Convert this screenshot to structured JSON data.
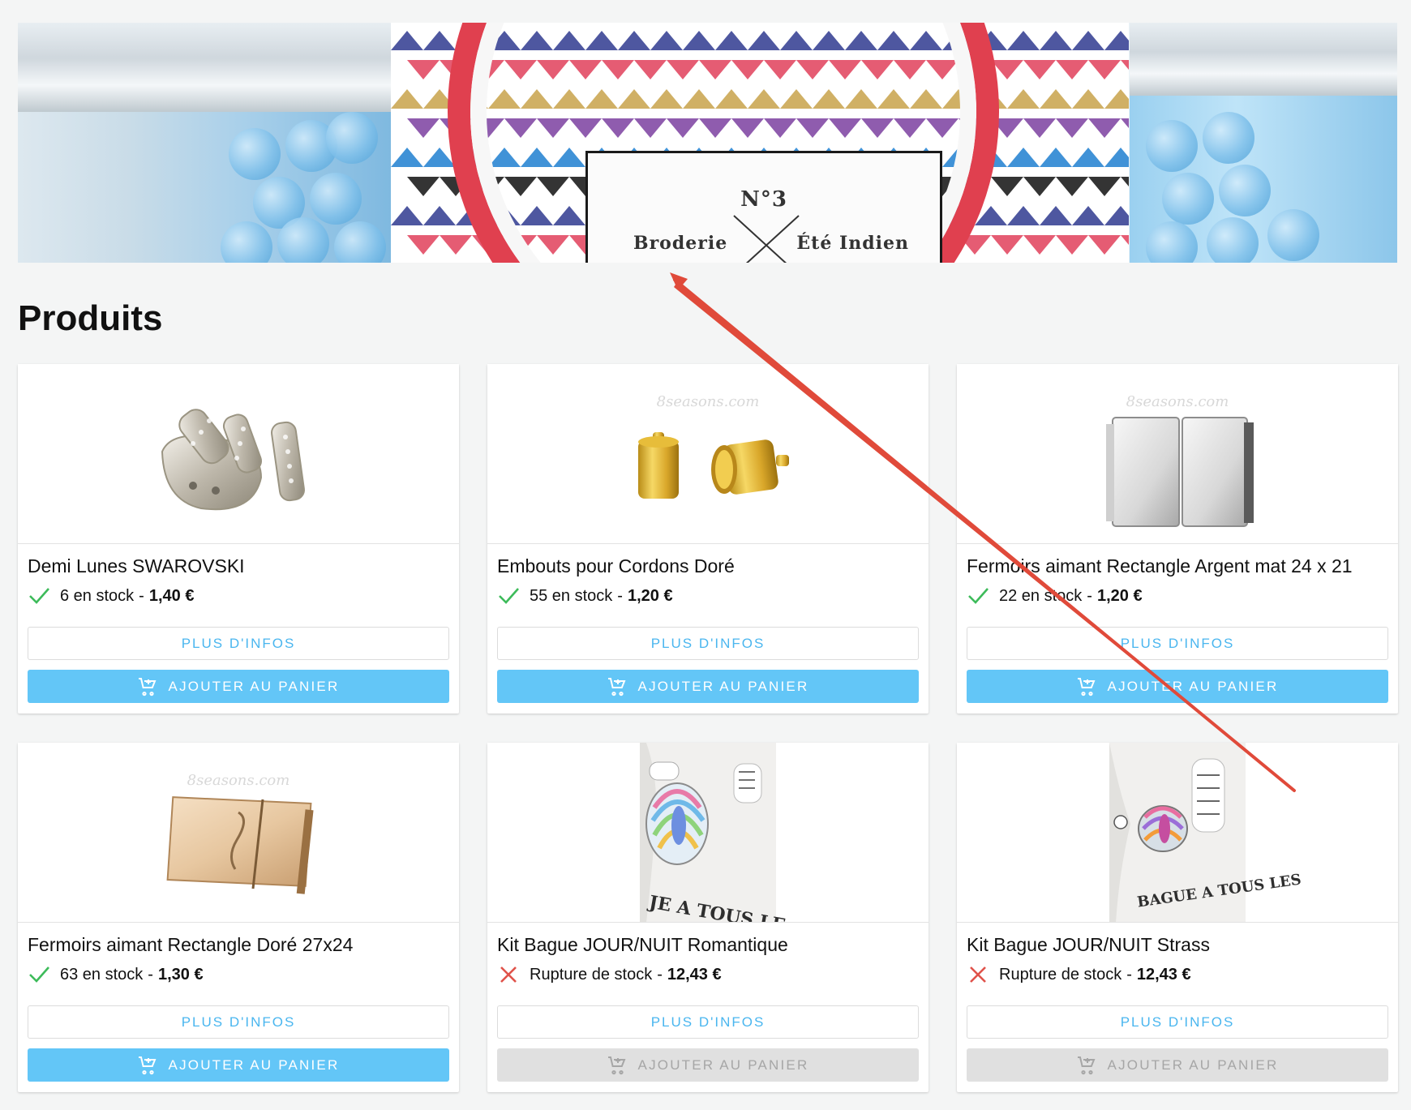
{
  "page": {
    "title": "Produits"
  },
  "banner": {
    "label_number": "N°3",
    "label_left": "Broderie",
    "label_right": "Été Indien"
  },
  "products": [
    {
      "name": "Demi Lunes SWAROVSKI",
      "stock_text": "6 en stock",
      "in_stock": true,
      "price": "1,40 €",
      "info_label": "PLUS D'INFOS",
      "cart_label": "AJOUTER AU PANIER",
      "image": "swarovski-half-moon-beads"
    },
    {
      "name": "Embouts pour Cordons Doré",
      "stock_text": "55 en stock",
      "in_stock": true,
      "price": "1,20 €",
      "info_label": "PLUS D'INFOS",
      "cart_label": "AJOUTER AU PANIER",
      "image": "gold-cord-end-caps",
      "watermark": "8seasons.com"
    },
    {
      "name": "Fermoirs aimant Rectangle Argent mat 24 x 21",
      "stock_text": "22 en stock",
      "in_stock": true,
      "price": "1,20 €",
      "info_label": "PLUS D'INFOS",
      "cart_label": "AJOUTER AU PANIER",
      "image": "silver-magnetic-clasp",
      "watermark": "8seasons.com"
    },
    {
      "name": "Fermoirs aimant Rectangle Doré 27x24",
      "stock_text": "63 en stock",
      "in_stock": true,
      "price": "1,30 €",
      "info_label": "PLUS D'INFOS",
      "cart_label": "AJOUTER AU PANIER",
      "image": "gold-magnetic-clasp",
      "watermark": "8seasons.com"
    },
    {
      "name": "Kit Bague JOUR/NUIT Romantique",
      "stock_text": "Rupture de stock",
      "in_stock": false,
      "price": "12,43 €",
      "info_label": "PLUS D'INFOS",
      "cart_label": "AJOUTER AU PANIER",
      "image": "ring-kit-romantique",
      "image_text": "JE A TOUS LE"
    },
    {
      "name": "Kit Bague JOUR/NUIT Strass",
      "stock_text": "Rupture de stock",
      "in_stock": false,
      "price": "12,43 €",
      "info_label": "PLUS D'INFOS",
      "cart_label": "AJOUTER AU PANIER",
      "image": "ring-kit-strass",
      "image_text": "BAGUE A TOUS LES"
    }
  ],
  "price_separator": "-",
  "colors": {
    "accent": "#63c6f7",
    "accent_text": "#4ab6ef",
    "in_stock_check": "#3dbb5a",
    "out_of_stock_x": "#e0524a",
    "disabled_button": "#e0e0e0",
    "annotation_arrow": "#e04a3a"
  },
  "icons": {
    "in_stock": "check-icon",
    "out_of_stock": "x-icon",
    "cart": "add-to-cart-icon"
  }
}
